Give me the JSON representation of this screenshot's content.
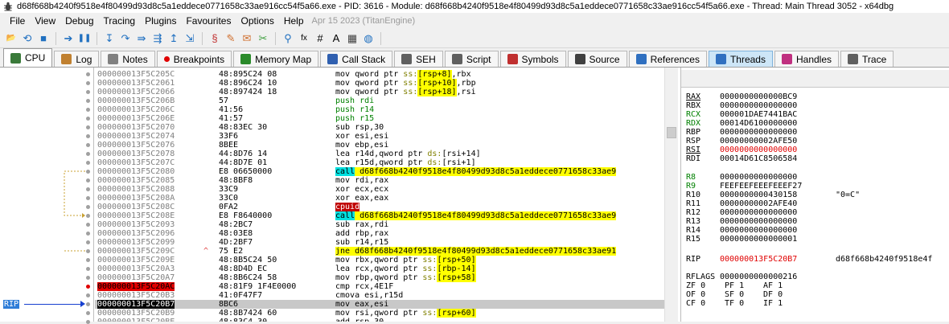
{
  "window": {
    "title": "d68f668b4240f9518e4f80499d93d8c5a1eddece0771658c33ae916cc54f5a66.exe - PID: 3616 - Module: d68f668b4240f9518e4f80499d93d8c5a1eddece0771658c33ae916cc54f5a66.exe - Thread: Main Thread 3052 - x64dbg"
  },
  "menu": {
    "items": [
      "File",
      "View",
      "Debug",
      "Tracing",
      "Plugins",
      "Favourites",
      "Options",
      "Help"
    ],
    "build_date": "Apr 15 2023 (TitanEngine)"
  },
  "toolbar": {
    "buttons": [
      {
        "name": "open-icon",
        "glyph": "📂",
        "color": "#d6a020"
      },
      {
        "name": "restart-icon",
        "glyph": "⟲",
        "color": "#2070c0"
      },
      {
        "name": "stop-icon",
        "glyph": "■",
        "color": "#2070c0"
      },
      {
        "name": "run-icon",
        "glyph": "➔",
        "color": "#2070c0"
      },
      {
        "name": "pause-icon",
        "glyph": "❚❚",
        "color": "#2070c0"
      },
      {
        "name": "step-into-icon",
        "glyph": "↧",
        "color": "#2070c0"
      },
      {
        "name": "step-over-icon",
        "glyph": "↷",
        "color": "#2070c0"
      },
      {
        "name": "trace-into-icon",
        "glyph": "⇛",
        "color": "#2070c0"
      },
      {
        "name": "trace-over-icon",
        "glyph": "⇶",
        "color": "#2070c0"
      },
      {
        "name": "execute-till-return-icon",
        "glyph": "↥",
        "color": "#2070c0"
      },
      {
        "name": "run-to-user-code-icon",
        "glyph": "⇲",
        "color": "#2070c0"
      },
      {
        "name": "scylla-icon",
        "glyph": "§",
        "color": "#c03030"
      },
      {
        "name": "patch-icon",
        "glyph": "✎",
        "color": "#d07030"
      },
      {
        "name": "comment-icon",
        "glyph": "✉",
        "color": "#d07030"
      },
      {
        "name": "label-icon",
        "glyph": "✂",
        "color": "#40a040"
      },
      {
        "name": "bookmark-icon",
        "glyph": "⚲",
        "color": "#2070c0"
      },
      {
        "name": "function-icon",
        "glyph": "fx",
        "color": "#000000"
      },
      {
        "name": "hash-icon",
        "glyph": "#",
        "color": "#000000"
      },
      {
        "name": "strings-icon",
        "glyph": "A",
        "color": "#000000"
      },
      {
        "name": "calculator-icon",
        "glyph": "▦",
        "color": "#404040"
      },
      {
        "name": "globe-icon",
        "glyph": "◍",
        "color": "#2070c0"
      }
    ]
  },
  "tabs": [
    {
      "label": "CPU",
      "icon": "cpu-icon",
      "active": true
    },
    {
      "label": "Log",
      "icon": "log-icon"
    },
    {
      "label": "Notes",
      "icon": "notes-icon"
    },
    {
      "label": "Breakpoints",
      "icon": "breakpoint-icon"
    },
    {
      "label": "Memory Map",
      "icon": "memory-map-icon"
    },
    {
      "label": "Call Stack",
      "icon": "call-stack-icon"
    },
    {
      "label": "SEH",
      "icon": "seh-icon"
    },
    {
      "label": "Script",
      "icon": "script-icon"
    },
    {
      "label": "Symbols",
      "icon": "symbols-icon"
    },
    {
      "label": "Source",
      "icon": "source-icon"
    },
    {
      "label": "References",
      "icon": "references-icon"
    },
    {
      "label": "Threads",
      "icon": "threads-icon",
      "selected": true
    },
    {
      "label": "Handles",
      "icon": "handles-icon"
    },
    {
      "label": "Trace",
      "icon": "trace-icon"
    }
  ],
  "rip_label": "RIP",
  "disassembly": [
    {
      "addr": "000000013F5C205C",
      "bytes": "48:895C24 08",
      "ins": [
        [
          "mov qword ptr ",
          ""
        ],
        [
          "ss:",
          "seg"
        ],
        [
          "[rsp+8]",
          "br"
        ],
        [
          ",rbx",
          ""
        ]
      ]
    },
    {
      "addr": "000000013F5C2061",
      "bytes": "48:896C24 10",
      "ins": [
        [
          "mov qword ptr ",
          ""
        ],
        [
          "ss:",
          "seg"
        ],
        [
          "[rsp+10]",
          "br"
        ],
        [
          ",rbp",
          ""
        ]
      ]
    },
    {
      "addr": "000000013F5C2066",
      "bytes": "48:897424 18",
      "ins": [
        [
          "mov qword ptr ",
          ""
        ],
        [
          "ss:",
          "seg"
        ],
        [
          "[rsp+18]",
          "br"
        ],
        [
          ",rsi",
          ""
        ]
      ]
    },
    {
      "addr": "000000013F5C206B",
      "bytes": "57",
      "ins": [
        [
          "push rdi",
          "k-push"
        ]
      ]
    },
    {
      "addr": "000000013F5C206C",
      "bytes": "41:56",
      "ins": [
        [
          "push r14",
          "k-push"
        ]
      ]
    },
    {
      "addr": "000000013F5C206E",
      "bytes": "41:57",
      "ins": [
        [
          "push r15",
          "k-push"
        ]
      ]
    },
    {
      "addr": "000000013F5C2070",
      "bytes": "48:83EC 30",
      "ins": [
        [
          "sub rsp,30",
          ""
        ]
      ]
    },
    {
      "addr": "000000013F5C2074",
      "bytes": "33F6",
      "ins": [
        [
          "xor esi,esi",
          ""
        ]
      ]
    },
    {
      "addr": "000000013F5C2076",
      "bytes": "8BEE",
      "ins": [
        [
          "mov ebp,esi",
          ""
        ]
      ]
    },
    {
      "addr": "000000013F5C2078",
      "bytes": "44:8D76 14",
      "ins": [
        [
          "lea r14d,qword ptr ",
          ""
        ],
        [
          "ds:",
          "seg"
        ],
        [
          "[rsi+14]",
          ""
        ]
      ]
    },
    {
      "addr": "000000013F5C207C",
      "bytes": "44:8D7E 01",
      "ins": [
        [
          "lea r15d,qword ptr ",
          ""
        ],
        [
          "ds:",
          "seg"
        ],
        [
          "[rsi+1]",
          ""
        ]
      ]
    },
    {
      "addr": "000000013F5C2080",
      "bytes": "E8 06650000",
      "ins": [
        [
          "call",
          "k-call"
        ],
        [
          " d68f668b4240f9518e4f80499d93d8c5a1eddece0771658c33ae9",
          "k-call2"
        ]
      ]
    },
    {
      "addr": "000000013F5C2085",
      "bytes": "48:8BF8",
      "ins": [
        [
          "mov rdi,rax",
          ""
        ]
      ]
    },
    {
      "addr": "000000013F5C2088",
      "bytes": "33C9",
      "ins": [
        [
          "xor ecx,ecx",
          ""
        ]
      ]
    },
    {
      "addr": "000000013F5C208A",
      "bytes": "33C0",
      "ins": [
        [
          "xor eax,eax",
          ""
        ]
      ]
    },
    {
      "addr": "000000013F5C208C",
      "bytes": "0FA2",
      "ins": [
        [
          "cpuid",
          "k-cpuid"
        ]
      ]
    },
    {
      "addr": "000000013F5C208E",
      "bytes": "E8 F8640000",
      "ins": [
        [
          "call",
          "k-call"
        ],
        [
          " d68f668b4240f9518e4f80499d93d8c5a1eddece0771658c33ae9",
          "k-call2"
        ]
      ]
    },
    {
      "addr": "000000013F5C2093",
      "bytes": "48:2BC7",
      "ins": [
        [
          "sub rax,rdi",
          ""
        ]
      ]
    },
    {
      "addr": "000000013F5C2096",
      "bytes": "48:03E8",
      "ins": [
        [
          "add rbp,rax",
          ""
        ]
      ]
    },
    {
      "addr": "000000013F5C2099",
      "bytes": "4D:2BF7",
      "ins": [
        [
          "sub r14,r15",
          ""
        ]
      ]
    },
    {
      "addr": "000000013F5C209C",
      "bytes": "75 E2",
      "mark": "^",
      "ins": [
        [
          "jne",
          "k-jne"
        ],
        [
          " d68f668b4240f9518e4f80499d93d8c5a1eddece0771658c33ae91",
          "k-call2"
        ]
      ]
    },
    {
      "addr": "000000013F5C209E",
      "bytes": "48:8B5C24 50",
      "ins": [
        [
          "mov rbx,qword ptr ",
          ""
        ],
        [
          "ss:",
          "seg"
        ],
        [
          "[rsp+50]",
          "br"
        ]
      ]
    },
    {
      "addr": "000000013F5C20A3",
      "bytes": "48:8D4D EC",
      "ins": [
        [
          "lea rcx,qword ptr ",
          ""
        ],
        [
          "ss:",
          "seg"
        ],
        [
          "[rbp-14]",
          "br"
        ]
      ]
    },
    {
      "addr": "000000013F5C20A7",
      "bytes": "48:8B6C24 58",
      "ins": [
        [
          "mov rbp,qword ptr ",
          ""
        ],
        [
          "ss:",
          "seg"
        ],
        [
          "[rsp+58]",
          "br"
        ]
      ]
    },
    {
      "addr": "000000013F5C20AC",
      "bytes": "48:81F9 1F4E0000",
      "bp": true,
      "ins": [
        [
          "cmp rcx,4E1F",
          ""
        ]
      ]
    },
    {
      "addr": "000000013F5C20B3",
      "bytes": "41:0F47F7",
      "ins": [
        [
          "cmova esi,r15d",
          ""
        ]
      ]
    },
    {
      "addr": "000000013F5C20B7",
      "bytes": "8BC6",
      "cur": true,
      "ins": [
        [
          "mov eax,esi",
          ""
        ]
      ]
    },
    {
      "addr": "000000013F5C20B9",
      "bytes": "48:8B7424 60",
      "ins": [
        [
          "mov rsi,qword ptr ",
          ""
        ],
        [
          "ss:",
          "seg"
        ],
        [
          "[rsp+60]",
          "br"
        ]
      ]
    },
    {
      "addr": "000000013F5C20BE",
      "bytes": "48:83C4 30",
      "ins": [
        [
          "add rsp,30",
          ""
        ]
      ]
    }
  ],
  "registers": {
    "general": [
      {
        "name": "RAX",
        "value": "0000000000000BC9",
        "name_color": "#000000",
        "value_color": "#000000",
        "underline": true
      },
      {
        "name": "RBX",
        "value": "0000000000000000",
        "name_color": "#000000",
        "value_color": "#000000"
      },
      {
        "name": "RCX",
        "value": "000001DAE7441BAC",
        "name_color": "#008000",
        "value_color": "#000000"
      },
      {
        "name": "RDX",
        "value": "00014D6100000000",
        "name_color": "#008000",
        "value_color": "#000000"
      },
      {
        "name": "RBP",
        "value": "0000000000000000",
        "name_color": "#000000",
        "value_color": "#000000"
      },
      {
        "name": "RSP",
        "value": "00000000002AFE50",
        "name_color": "#000000",
        "value_color": "#000000"
      },
      {
        "name": "RSI",
        "value": "0000000000000000",
        "name_color": "#000000",
        "value_color": "#e00000",
        "underline": true
      },
      {
        "name": "RDI",
        "value": "00014D61C8506584",
        "name_color": "#000000",
        "value_color": "#000000"
      }
    ],
    "extended": [
      {
        "name": "R8",
        "value": "0000000000000000",
        "name_color": "#008000",
        "value_color": "#000000"
      },
      {
        "name": "R9",
        "value": "FEEFEEFEEEFEEEF27",
        "name_color": "#008000",
        "value_color": "#000000"
      },
      {
        "name": "R10",
        "value": "0000000000430158",
        "name_color": "#000000",
        "value_color": "#000000",
        "comment": "\"0=C\""
      },
      {
        "name": "R11",
        "value": "00000000002AFE40",
        "name_color": "#000000",
        "value_color": "#000000"
      },
      {
        "name": "R12",
        "value": "0000000000000000",
        "name_color": "#000000",
        "value_color": "#000000"
      },
      {
        "name": "R13",
        "value": "0000000000000000",
        "name_color": "#000000",
        "value_color": "#000000"
      },
      {
        "name": "R14",
        "value": "0000000000000000",
        "name_color": "#000000",
        "value_color": "#000000"
      },
      {
        "name": "R15",
        "value": "0000000000000001",
        "name_color": "#000000",
        "value_color": "#000000"
      }
    ],
    "rip": {
      "name": "RIP",
      "value": "000000013F5C20B7",
      "comment": "d68f668b4240f9518e4f"
    },
    "rflags": {
      "name": "RFLAGS",
      "value": "0000000000000216"
    },
    "flags": [
      [
        "ZF",
        "0"
      ],
      [
        "PF",
        "1"
      ],
      [
        "AF",
        "1"
      ],
      [
        "OF",
        "0"
      ],
      [
        "SF",
        "0"
      ],
      [
        "DF",
        "0"
      ],
      [
        "CF",
        "0"
      ],
      [
        "TF",
        "0"
      ],
      [
        "IF",
        "1"
      ]
    ]
  }
}
